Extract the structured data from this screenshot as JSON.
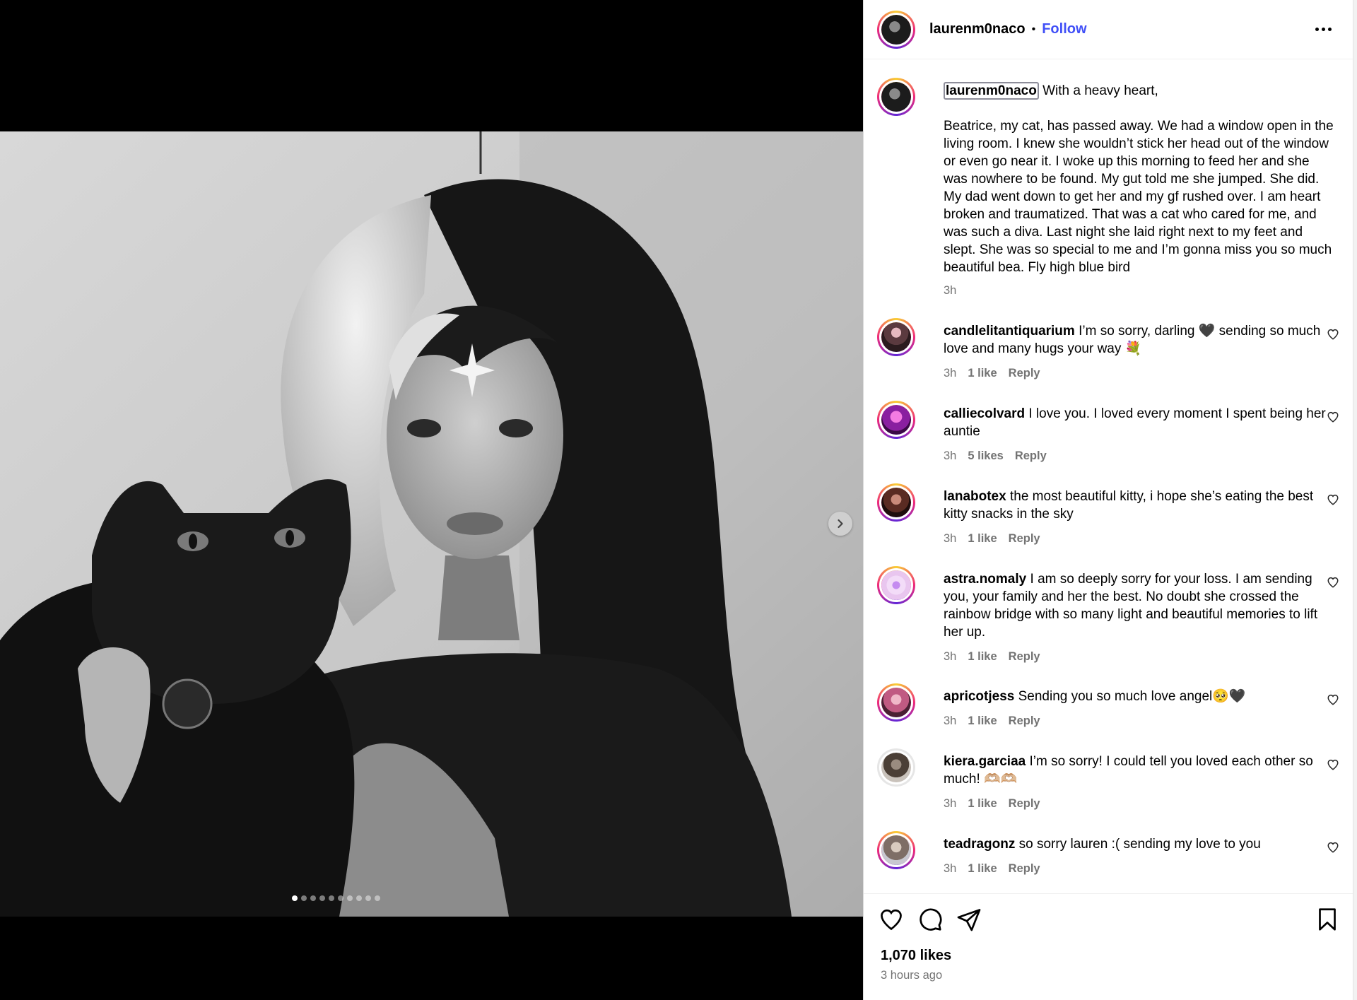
{
  "header": {
    "username": "laurenm0naco",
    "separator": "•",
    "follow_label": "Follow"
  },
  "caption": {
    "username": "laurenm0naco",
    "opening": "With a heavy heart,",
    "text": "Beatrice, my cat, has passed away. We had a window open in the living room. I knew she wouldn’t stick her head out of the window or even go near it. I woke up this morning to feed her and she was nowhere to be found. My gut told me she jumped. She did. My dad went down to get her and my gf rushed over. I am heart broken and traumatized. That was a cat who cared for me, and was such a diva. Last night she laid right next to my feet and slept. She was so special to me and I’m gonna miss you so much beautiful bea. Fly high blue bird",
    "time": "3h"
  },
  "comments": [
    {
      "username": "candlelitantiquarium",
      "text": "I’m so sorry, darling 🖤 sending so much love and many hugs your way 💐",
      "time": "3h",
      "likes": "1 like",
      "reply": "Reply"
    },
    {
      "username": "calliecolvard",
      "text": "I love you. I loved every moment I spent being her auntie",
      "time": "3h",
      "likes": "5 likes",
      "reply": "Reply"
    },
    {
      "username": "lanabotex",
      "text": "the most beautiful kitty, i hope she’s eating the best kitty snacks in the sky",
      "time": "3h",
      "likes": "1 like",
      "reply": "Reply"
    },
    {
      "username": "astra.nomaly",
      "text": "I am so deeply sorry for your loss. I am sending you, your family and her the best. No doubt she crossed the rainbow bridge with so many light and beautiful memories to lift her up.",
      "time": "3h",
      "likes": "1 like",
      "reply": "Reply"
    },
    {
      "username": "apricotjess",
      "text": "Sending you so much love angel🥺🖤",
      "time": "3h",
      "likes": "1 like",
      "reply": "Reply"
    },
    {
      "username": "kiera.garciaa",
      "text": "I’m so sorry! I could tell you loved each other so much! 🫶🏼🫶🏼",
      "time": "3h",
      "likes": "1 like",
      "reply": "Reply"
    },
    {
      "username": "teadragonz",
      "text": "so sorry lauren :( sending my love to you",
      "time": "3h",
      "likes": "1 like",
      "reply": "Reply"
    }
  ],
  "footer": {
    "likes": "1,070 likes",
    "time_ago": "3 hours ago"
  },
  "carousel": {
    "total_slides": 10,
    "active_index": 0
  },
  "colors": {
    "accent_blue": "#4150f7",
    "meta_gray": "#737373"
  },
  "icons": {
    "like": "heart-icon",
    "comment": "comment-icon",
    "share": "send-icon",
    "save": "bookmark-icon",
    "more": "ellipsis-icon",
    "next": "chevron-right-icon"
  }
}
